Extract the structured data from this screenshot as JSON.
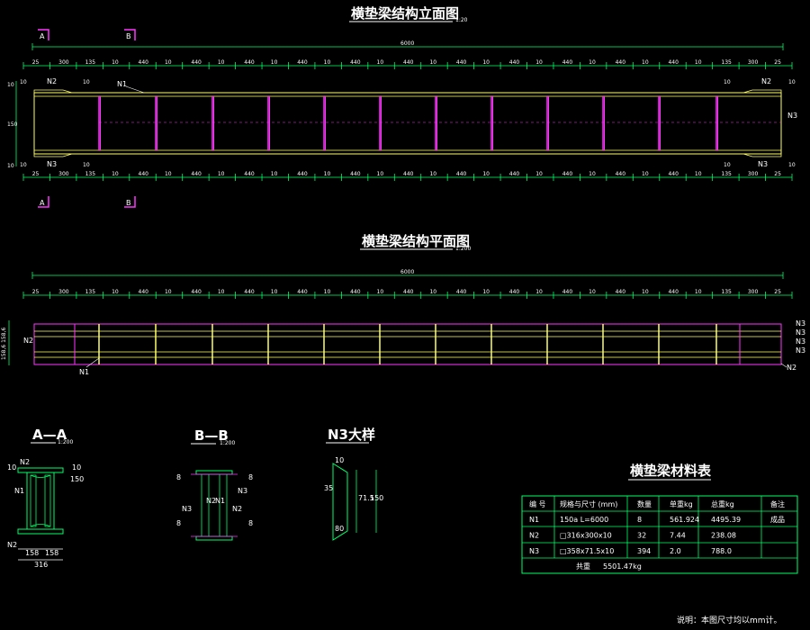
{
  "colors": {
    "background": "#000000",
    "outline": "#ffff66",
    "stiffener": "#ff33ff",
    "dimension": "#00ff66",
    "text": "#ffffff",
    "marker": "#ff33ff"
  },
  "elevation": {
    "title": "横垫梁结构立面图",
    "scale": "1:20",
    "total_length": "6000",
    "section_markers": [
      "A",
      "B"
    ],
    "top_dims": [
      "25",
      "300",
      "135",
      "10",
      "440",
      "10",
      "440",
      "10",
      "440",
      "10",
      "440",
      "10",
      "440",
      "10",
      "440",
      "10",
      "440",
      "10",
      "440",
      "10",
      "440",
      "10",
      "440",
      "10",
      "440",
      "10",
      "135",
      "300",
      "25"
    ],
    "bottom_dims": [
      "25",
      "300",
      "135",
      "10",
      "440",
      "10",
      "440",
      "10",
      "440",
      "10",
      "440",
      "10",
      "440",
      "10",
      "440",
      "10",
      "440",
      "10",
      "440",
      "10",
      "440",
      "10",
      "440",
      "10",
      "440",
      "10",
      "135",
      "300",
      "25"
    ],
    "labels": {
      "n1": "N1",
      "n2_left": "N2",
      "n2_right": "N2",
      "n3_left": "N3",
      "n3_right": "N3",
      "n3_end": "N3",
      "h_top": "10",
      "h_mid": "150",
      "h_bot": "10",
      "tick10": "10"
    }
  },
  "plan": {
    "title": "横垫梁结构平面图",
    "scale": "1:200",
    "total_length": "6000",
    "top_dims": [
      "25",
      "300",
      "135",
      "10",
      "440",
      "10",
      "440",
      "10",
      "440",
      "10",
      "440",
      "10",
      "440",
      "10",
      "440",
      "10",
      "440",
      "10",
      "440",
      "10",
      "440",
      "10",
      "440",
      "10",
      "440",
      "10",
      "135",
      "300",
      "25"
    ],
    "labels": {
      "n2": "N2",
      "n1": "N1",
      "n3_a": "N3",
      "n3_b": "N3",
      "n3_c": "N3",
      "n3_d": "N3",
      "n2_right": "N2",
      "left_dims": "158,6 158,6"
    }
  },
  "section_aa": {
    "title": "A—A",
    "scale": "1:200",
    "labels": {
      "n2": "N2",
      "n1": "N1",
      "n2_bot": "N2",
      "dim10_l": "10",
      "dim10_r": "10",
      "d158_l": "158",
      "d158_r": "158",
      "total": "316",
      "side": "150"
    }
  },
  "section_bb": {
    "title": "B—B",
    "scale": "1:200",
    "labels": {
      "n3_l": "N3",
      "n3_r": "N3",
      "n2_l": "N2",
      "n2_r": "N2",
      "n1": "N1",
      "d8_tl": "8",
      "d8_tr": "8",
      "d8_bl": "8",
      "d8_br": "8"
    }
  },
  "detail_n3": {
    "title": "N3大样",
    "labels": {
      "d10": "10",
      "d35": "35",
      "d715": "71.5",
      "d150": "150",
      "d80": "80"
    }
  },
  "material_table": {
    "title": "横垫梁材料表",
    "headers": [
      "编  号",
      "规格与尺寸 (mm)",
      "数量",
      "单重kg",
      "总重kg",
      "备注"
    ],
    "rows": [
      [
        "N1",
        "150a    L=6000",
        "8",
        "561.924",
        "4495.39",
        "成品"
      ],
      [
        "N2",
        "□316x300x10",
        "32",
        "7.44",
        "238.08",
        ""
      ],
      [
        "N3",
        "□358x71.5x10",
        "394",
        "2.0",
        "788.0",
        ""
      ]
    ],
    "total_label": "共重",
    "total_value": "5501.47kg"
  },
  "note": "说明：本图尺寸均以mm计。"
}
